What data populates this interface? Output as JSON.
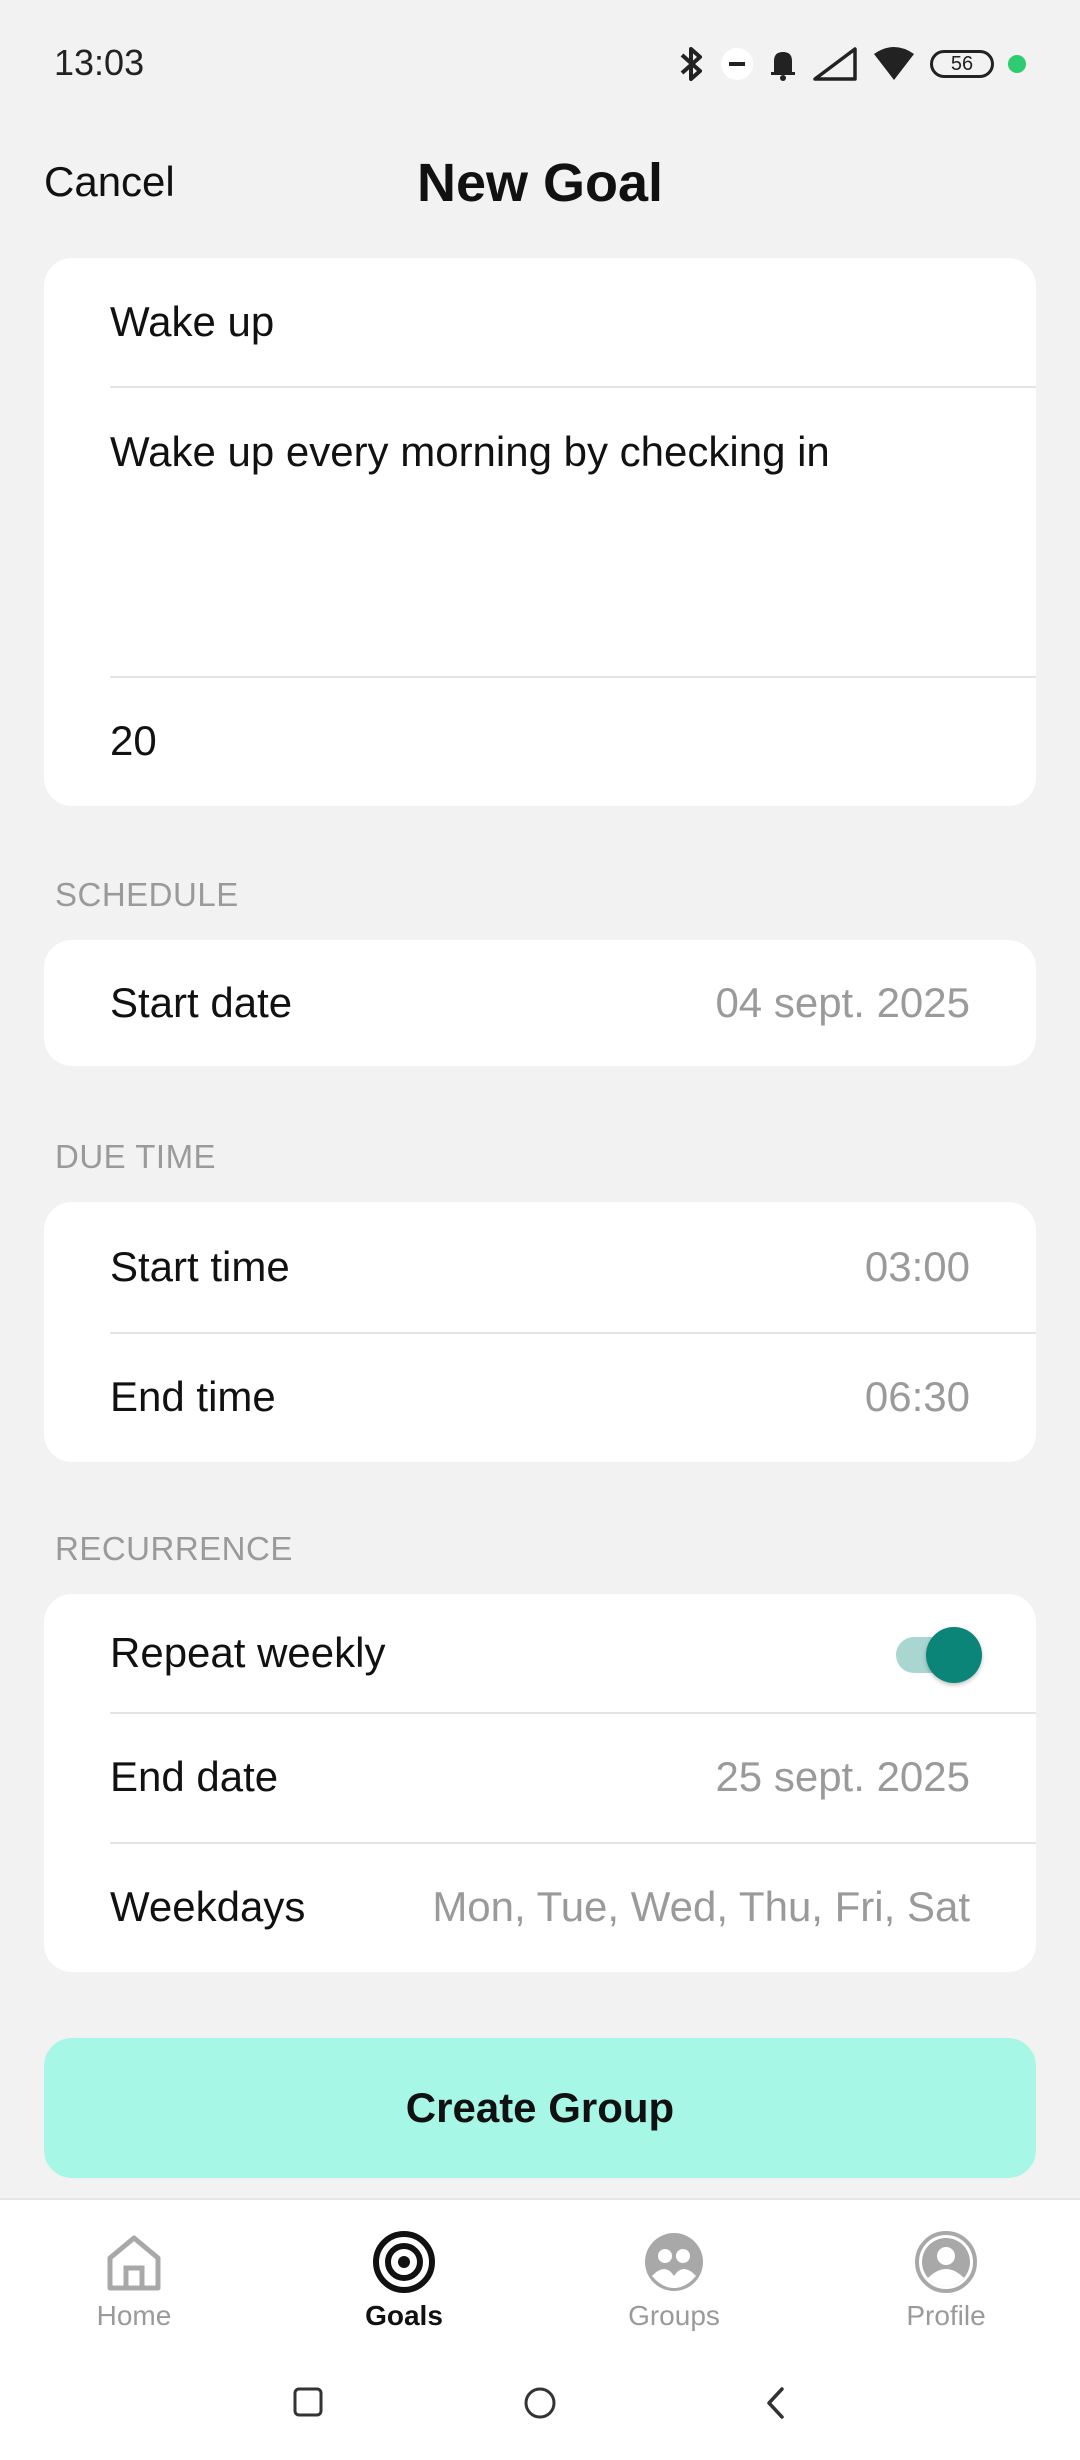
{
  "status_bar": {
    "time": "13:03",
    "battery_level": "56",
    "icons": [
      "bluetooth-icon",
      "dnd-icon",
      "bell-icon",
      "signal-icon",
      "wifi-icon",
      "battery-icon",
      "dot-icon"
    ]
  },
  "header": {
    "cancel_label": "Cancel",
    "title": "New Goal"
  },
  "details": {
    "name_value": "Wake up",
    "description_value": "Wake up every morning by checking in",
    "number_value": "20"
  },
  "schedule": {
    "section_label": "SCHEDULE",
    "start_date_label": "Start date",
    "start_date_value": "04 sept. 2025"
  },
  "due_time": {
    "section_label": "DUE TIME",
    "start_time_label": "Start time",
    "start_time_value": "03:00",
    "end_time_label": "End time",
    "end_time_value": "06:30"
  },
  "recurrence": {
    "section_label": "RECURRENCE",
    "repeat_label": "Repeat weekly",
    "repeat_enabled": true,
    "end_date_label": "End date",
    "end_date_value": "25 sept. 2025",
    "weekdays_label": "Weekdays",
    "weekdays_value": "Mon, Tue, Wed, Thu, Fri, Sat"
  },
  "create_button": {
    "label": "Create Group"
  },
  "bottom_nav": {
    "items": [
      {
        "label": "Home",
        "icon": "home-icon",
        "active": false
      },
      {
        "label": "Goals",
        "icon": "target-icon",
        "active": true
      },
      {
        "label": "Groups",
        "icon": "groups-icon",
        "active": false
      },
      {
        "label": "Profile",
        "icon": "profile-icon",
        "active": false
      }
    ]
  },
  "colors": {
    "background": "#f2f2f2",
    "accent": "#0b8577",
    "button": "#a6f7e6",
    "muted_text": "#9a9a9a"
  }
}
